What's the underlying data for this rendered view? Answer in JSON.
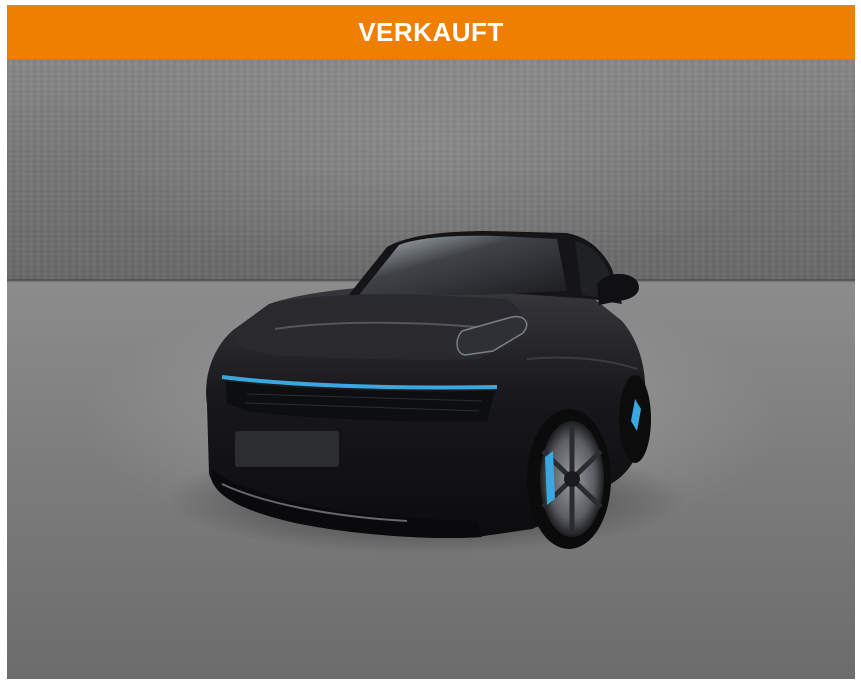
{
  "banner": {
    "label": "VERKAUFT",
    "color": "#ee7f00",
    "text_color": "#ffffff"
  },
  "photo": {
    "subject": "black-suv-car",
    "accent_color": "#3aa8e0"
  }
}
